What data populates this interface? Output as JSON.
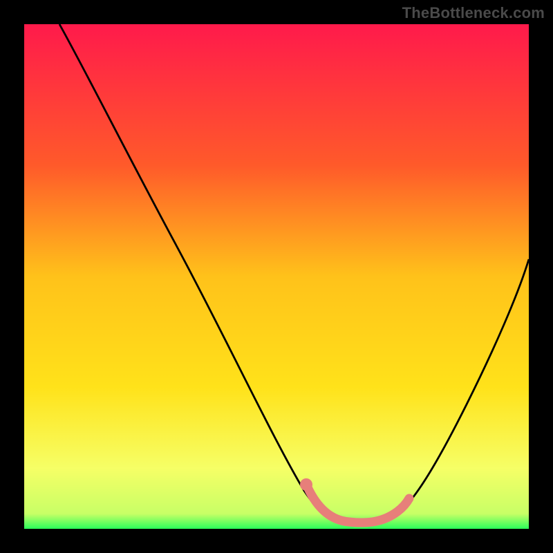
{
  "watermark": "TheBottleneck.com",
  "colors": {
    "background": "#000000",
    "gradient_top": "#ff1a4b",
    "gradient_mid1": "#ff7a1f",
    "gradient_mid2": "#ffe21a",
    "gradient_mid3": "#f6ff66",
    "gradient_bottom": "#2aff5a",
    "curve": "#000000",
    "highlight": "#e77f7a",
    "watermark_text": "#4a4a4a"
  },
  "chart_data": {
    "type": "line",
    "title": "",
    "xlabel": "",
    "ylabel": "",
    "xlim": [
      0,
      100
    ],
    "ylim": [
      0,
      100
    ],
    "series": [
      {
        "name": "bottleneck-curve",
        "x": [
          7,
          12,
          18,
          24,
          30,
          36,
          42,
          48,
          54,
          56,
          58,
          62,
          66,
          70,
          73,
          76,
          80,
          84,
          88,
          92,
          96,
          100
        ],
        "y": [
          100,
          91,
          82,
          72,
          62,
          52,
          42,
          32,
          18,
          10,
          5,
          2,
          2,
          2,
          3,
          5,
          10,
          18,
          28,
          38,
          48,
          58
        ]
      },
      {
        "name": "highlight-segment",
        "x": [
          56,
          58,
          62,
          66,
          70,
          73,
          75
        ],
        "y": [
          9,
          5,
          3,
          2,
          2,
          4,
          6
        ]
      }
    ],
    "annotations": [
      {
        "type": "point",
        "name": "highlight-start-dot",
        "x": 56,
        "y": 9
      }
    ]
  }
}
